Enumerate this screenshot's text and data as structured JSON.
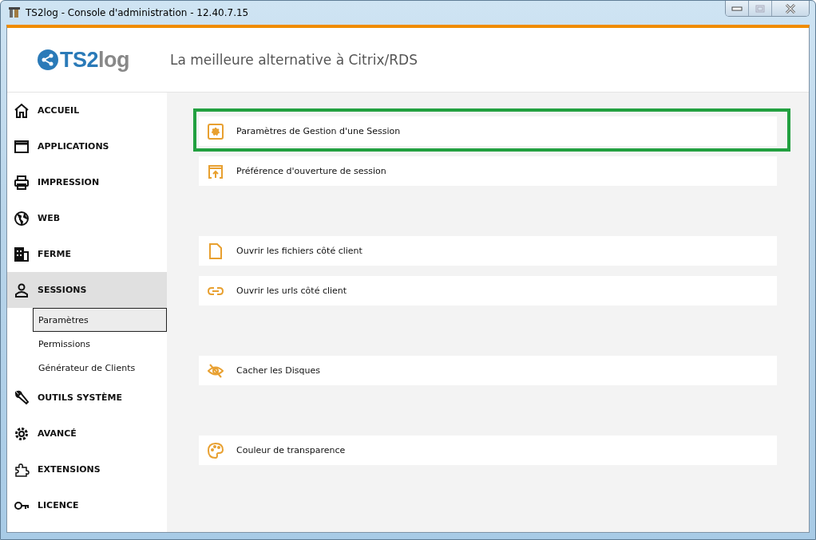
{
  "window": {
    "title": "TS2log - Console d'administration - 12.40.7.15"
  },
  "header": {
    "logo_text_1": "TS2",
    "logo_text_2": "log",
    "tagline": "La meilleure alternative à Citrix/RDS"
  },
  "sidebar": {
    "items": [
      {
        "label": "ACCUEIL",
        "selected": false
      },
      {
        "label": "APPLICATIONS",
        "selected": false
      },
      {
        "label": "IMPRESSION",
        "selected": false
      },
      {
        "label": "WEB",
        "selected": false
      },
      {
        "label": "FERME",
        "selected": false
      },
      {
        "label": "SESSIONS",
        "selected": true,
        "children": [
          {
            "label": "Paramètres",
            "selected": true
          },
          {
            "label": "Permissions",
            "selected": false
          },
          {
            "label": "Générateur de Clients",
            "selected": false
          }
        ]
      },
      {
        "label": "OUTILS SYSTÈME",
        "selected": false
      },
      {
        "label": "AVANCÉ",
        "selected": false
      },
      {
        "label": "EXTENSIONS",
        "selected": false
      },
      {
        "label": "LICENCE",
        "selected": false
      }
    ]
  },
  "groups": [
    {
      "items": [
        {
          "label": "Paramètres de Gestion d'une Session",
          "highlighted": true
        },
        {
          "label": "Préférence d'ouverture de session",
          "highlighted": false
        }
      ]
    },
    {
      "items": [
        {
          "label": "Ouvrir les fichiers côté client",
          "highlighted": false
        },
        {
          "label": "Ouvrir les urls côté client",
          "highlighted": false
        }
      ]
    },
    {
      "items": [
        {
          "label": "Cacher les Disques",
          "highlighted": false
        }
      ]
    },
    {
      "items": [
        {
          "label": "Couleur de transparence",
          "highlighted": false
        }
      ]
    }
  ]
}
